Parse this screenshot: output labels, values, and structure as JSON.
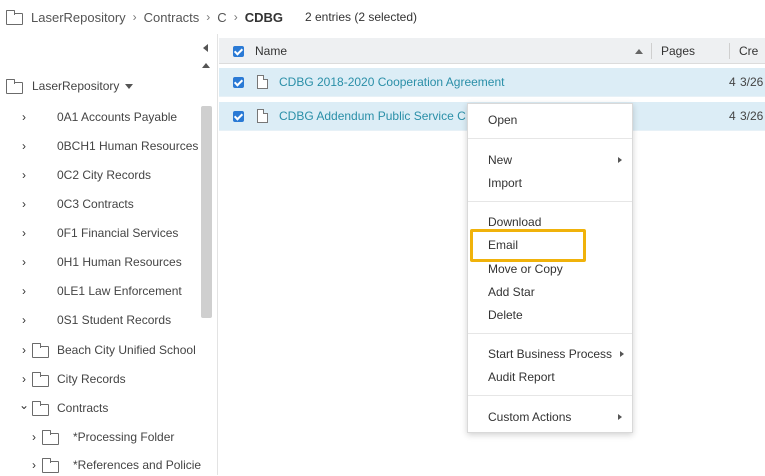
{
  "breadcrumb": {
    "root": "LaserRepository",
    "level1": "Contracts",
    "level2": "C",
    "current": "CDBG",
    "sep": "›",
    "entries": "2 entries (2 selected)"
  },
  "tree": {
    "root_label": "LaserRepository",
    "chev_right": "›",
    "chev_down": "⌄",
    "items": [
      {
        "label": "0A1 Accounts Payable"
      },
      {
        "label": "0BCH1 Human Resources"
      },
      {
        "label": "0C2 City Records"
      },
      {
        "label": "0C3 Contracts"
      },
      {
        "label": "0F1 Financial Services"
      },
      {
        "label": "0H1 Human Resources"
      },
      {
        "label": "0LE1 Law Enforcement"
      },
      {
        "label": "0S1 Student Records"
      }
    ],
    "folders": [
      {
        "label": "Beach City Unified School"
      },
      {
        "label": "City Records"
      },
      {
        "label": "Contracts"
      }
    ],
    "subfolders": [
      {
        "label": "*Processing Folder"
      },
      {
        "label": "*References and Policie"
      }
    ]
  },
  "grid": {
    "columns": {
      "name": "Name",
      "pages": "Pages",
      "created": "Cre"
    },
    "rows": [
      {
        "name": "CDBG 2018-2020 Cooperation Agreement",
        "pages": "4",
        "created": "3/26"
      },
      {
        "name": "CDBG Addendum Public Service C",
        "pages": "4",
        "created": "3/26"
      }
    ]
  },
  "context_menu": {
    "open": "Open",
    "new": "New",
    "import": "Import",
    "download": "Download",
    "email": "Email",
    "move_or_copy": "Move or Copy",
    "add_star": "Add Star",
    "delete": "Delete",
    "start_business_process": "Start Business Process",
    "audit_report": "Audit Report",
    "custom_actions": "Custom Actions"
  },
  "colors": {
    "selected_row": "#dcedf6",
    "link_text": "#2a8fa8",
    "checkbox": "#2a7ad5",
    "highlight": "#f0b20a"
  }
}
